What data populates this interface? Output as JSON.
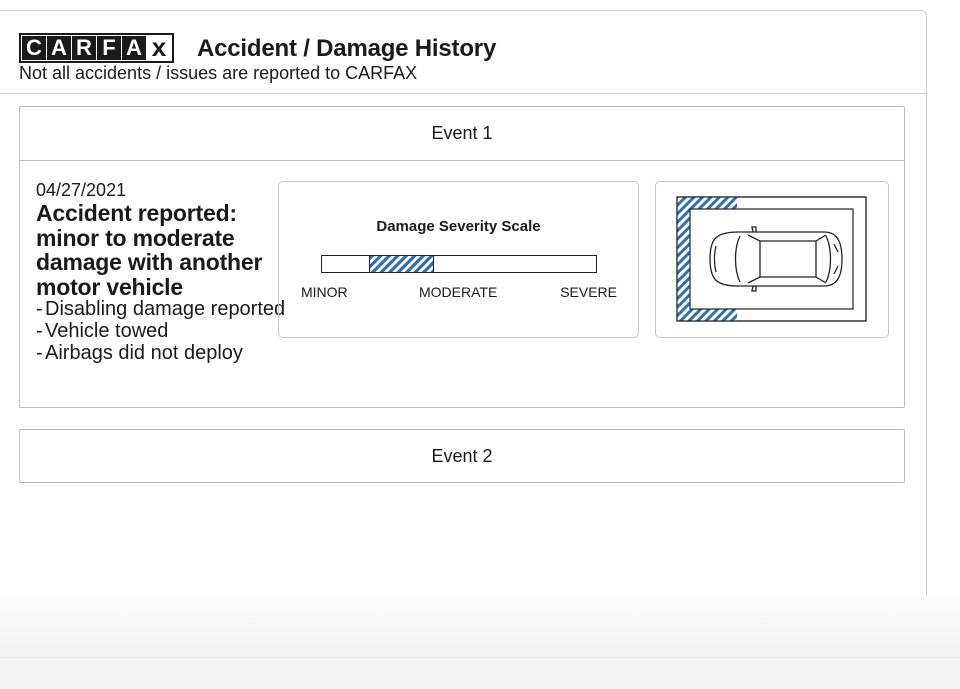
{
  "brand": {
    "letters": [
      "C",
      "A",
      "R",
      "F",
      "A",
      "x"
    ]
  },
  "header": {
    "title": "Accident / Damage History",
    "subtitle": "Not all accidents / issues are reported to CARFAX"
  },
  "events": [
    {
      "label": "Event 1",
      "date": "04/27/2021",
      "headline": "Accident reported: minor to moderate damage with another motor vehicle",
      "details": [
        "Disabling damage reported",
        "Vehicle towed",
        "Airbags did not deploy"
      ],
      "severity": {
        "title": "Damage Severity Scale",
        "labels": [
          "MINOR",
          "MODERATE",
          "SEVERE"
        ],
        "range": [
          0.17,
          0.41
        ]
      },
      "damage_diagram": {
        "icon": "car-top-view-icon",
        "impact_area": "front-left"
      }
    },
    {
      "label": "Event 2"
    }
  ],
  "colors": {
    "hatch": "#2f6fb8",
    "text": "#1a1a1a",
    "border": "#bdbdbd"
  }
}
